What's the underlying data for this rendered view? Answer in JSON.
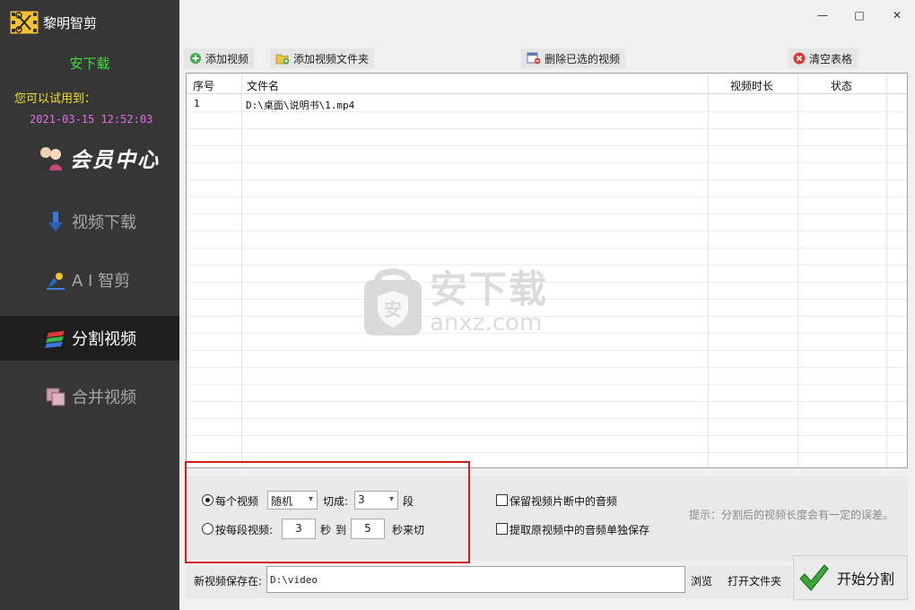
{
  "app": {
    "title": "黎明智剪"
  },
  "sidebar": {
    "brand": "安下载",
    "trial_label": "您可以试用到：",
    "trial_date": "2021-03-15 12:52:03",
    "member_center": "会员中心",
    "items": [
      {
        "label": "视频下载",
        "icon": "download-arrow-icon",
        "active": false
      },
      {
        "label": "A I 智剪",
        "icon": "ai-clip-icon",
        "active": false
      },
      {
        "label": "分割视频",
        "icon": "split-video-icon",
        "active": true
      },
      {
        "label": "合并视频",
        "icon": "merge-video-icon",
        "active": false
      }
    ]
  },
  "window": {
    "minimize": "—",
    "maximize": "□",
    "close": "✕"
  },
  "toolbar": {
    "add_video": "添加视频",
    "add_folder": "添加视频文件夹",
    "delete_selected": "删除已选的视频",
    "clear_table": "清空表格"
  },
  "table": {
    "columns": [
      "序号",
      "文件名",
      "视频时长",
      "状态"
    ],
    "rows": [
      {
        "index": "1",
        "filename": "D:\\桌面\\说明书\\1.mp4",
        "duration": "",
        "status": ""
      }
    ]
  },
  "watermark": {
    "cn": "安下载",
    "en": "anxz.com",
    "shield": "安"
  },
  "options": {
    "mode_each": "每个视频",
    "mode_each_selected": true,
    "split_mode_value": "随机",
    "cut_into_label": "切成:",
    "segments_value": "3",
    "segments_unit": "段",
    "mode_per_segment": "按每段视频:",
    "from_seconds": "3",
    "sec_label": "秒",
    "to_label": "到",
    "to_seconds": "5",
    "cut_by_sec_label": "秒来切",
    "keep_audio_label": "保留视频片断中的音频",
    "extract_audio_label": "提取原视频中的音频单独保存",
    "hint": "提示：分割后的视频长度会有一定的误差。"
  },
  "save": {
    "label": "新视频保存在:",
    "path": "D:\\video",
    "browse": "浏览",
    "open_folder": "打开文件夹"
  },
  "start": {
    "label": "开始分割"
  },
  "colors": {
    "sidebar_bg": "#363636",
    "active_item_bg": "#1e1e1e",
    "brand_green": "#3fe03f",
    "trial_yellow": "#f2e02a",
    "date_pink": "#e070e8",
    "frame_red": "#d02020"
  }
}
